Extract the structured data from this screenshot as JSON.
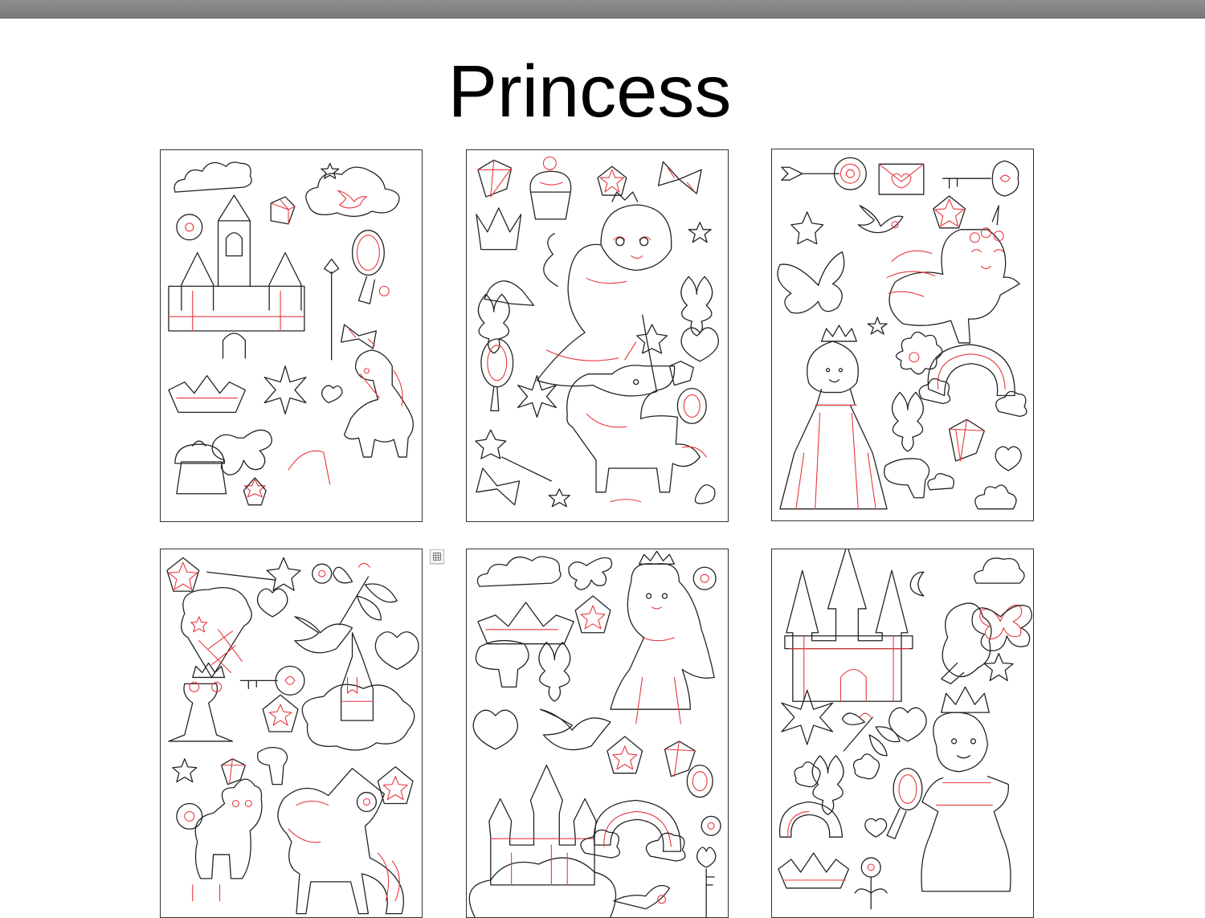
{
  "page": {
    "title": "Princess"
  },
  "colors": {
    "outline": "#222222",
    "accent_line": "#e8373d",
    "toolbar": "#888888"
  },
  "sheets": [
    {
      "name": "sheet-castle",
      "icons": [
        "cloud-icon",
        "castle-icon",
        "gem-icon",
        "mirror-icon",
        "wand-icon",
        "bow-icon",
        "crown-icon",
        "unicorn-icon",
        "cupcake-icon",
        "butterfly-icon",
        "star-icon",
        "heart-icon",
        "flower-icon",
        "bird-icon"
      ]
    },
    {
      "name": "sheet-fairy",
      "icons": [
        "gem-icon",
        "cupcake-icon",
        "star-icon",
        "bow-icon",
        "crown-icon",
        "fairy-icon",
        "fleur-de-lis-icon",
        "shoe-icon",
        "mirror-icon",
        "heart-icon",
        "unicorn-icon",
        "ring-icon",
        "wand-icon",
        "flower-icon"
      ]
    },
    {
      "name": "sheet-princess-rainbow",
      "icons": [
        "lollipop-icon",
        "envelope-icon",
        "key-icon",
        "star-icon",
        "bird-icon",
        "butterfly-icon",
        "unicorn-cat-icon",
        "princess-icon",
        "flower-icon",
        "rainbow-icon",
        "fleur-de-lis-icon",
        "gem-icon",
        "mushroom-icon",
        "heart-icon"
      ]
    },
    {
      "name": "sheet-frog-prince",
      "icons": [
        "wand-icon",
        "ice-cream-icon",
        "heart-icon",
        "dragonfly-icon",
        "bird-icon",
        "key-icon",
        "frog-icon",
        "castle-icon",
        "star-icon",
        "gem-icon",
        "mushroom-icon",
        "llama-icon",
        "unicorn-icon",
        "flower-icon"
      ]
    },
    {
      "name": "sheet-princess-castle",
      "icons": [
        "cloud-icon",
        "butterfly-icon",
        "crown-icon",
        "princess-icon",
        "flower-icon",
        "mushroom-icon",
        "fleur-de-lis-icon",
        "heart-icon",
        "bird-icon",
        "star-icon",
        "gem-icon",
        "castle-icon",
        "rainbow-icon",
        "key-icon"
      ]
    },
    {
      "name": "sheet-queen",
      "icons": [
        "castle-icon",
        "moon-icon",
        "cloud-icon",
        "tree-icon",
        "butterfly-icon",
        "star-icon",
        "flower-icon",
        "dragonfly-icon",
        "heart-icon",
        "queen-icon",
        "mirror-icon",
        "fleur-de-lis-icon",
        "rainbow-icon",
        "crown-icon"
      ]
    }
  ]
}
